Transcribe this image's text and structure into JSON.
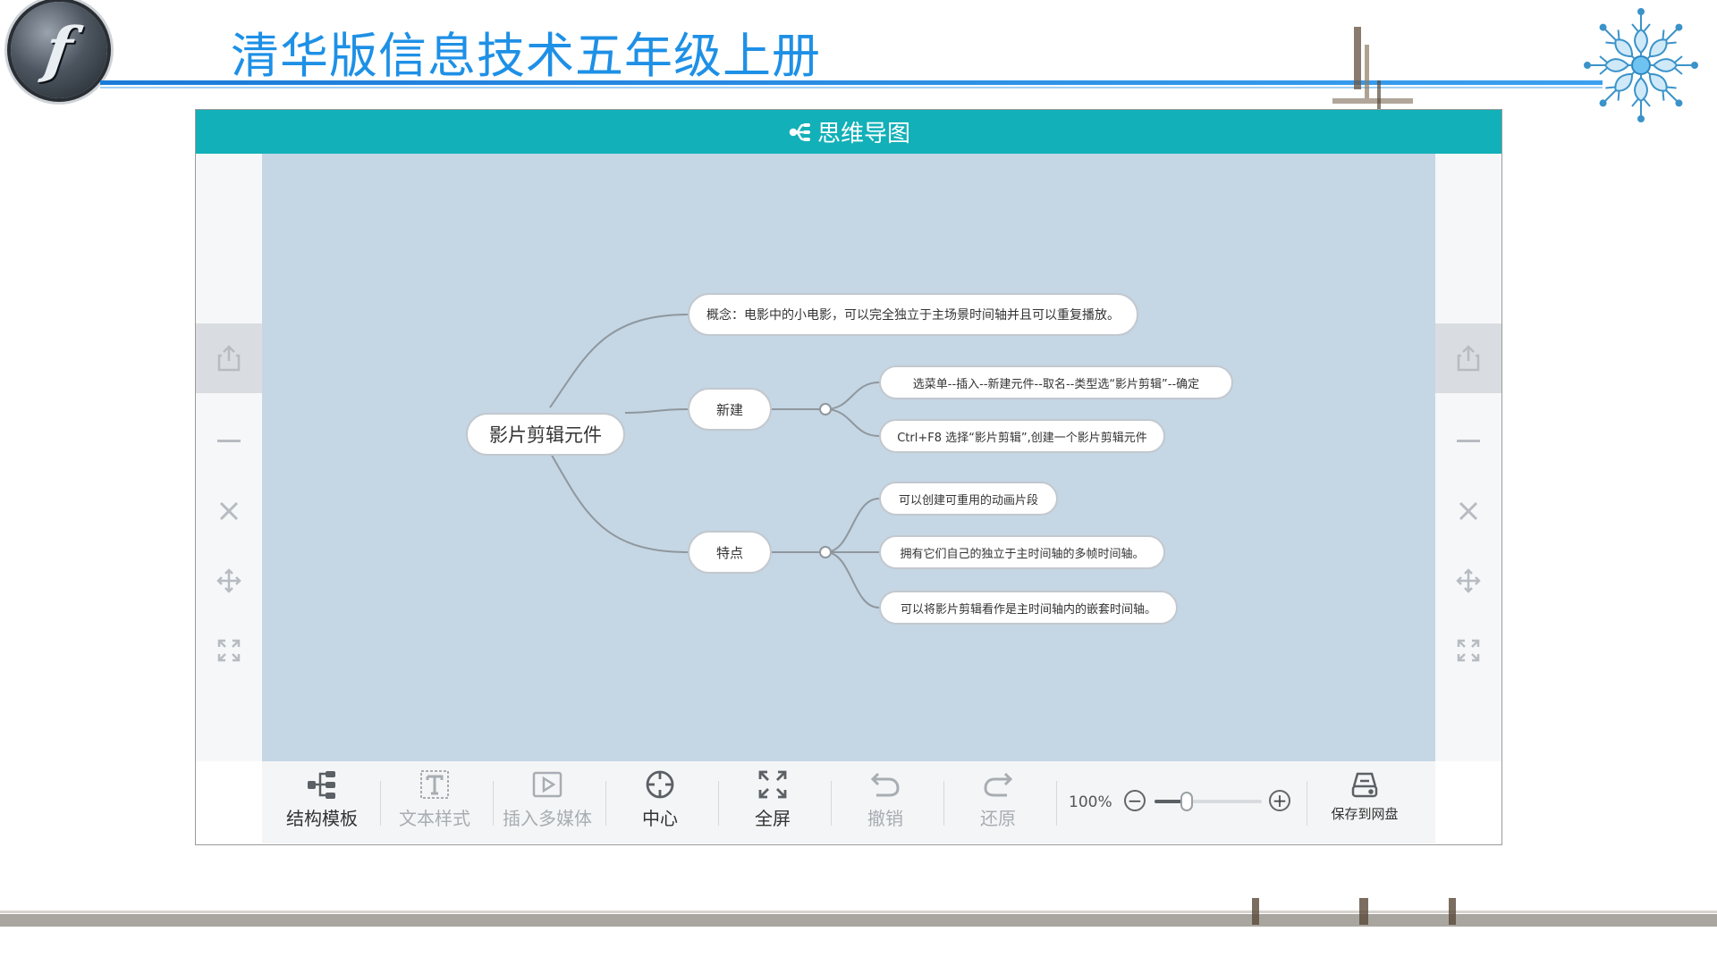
{
  "slide": {
    "title": "清华版信息技术五年级上册",
    "logo_letter": "f"
  },
  "app": {
    "header_title": "思维导图",
    "side_icons": [
      "share-icon",
      "minus-icon",
      "close-icon",
      "move-icon",
      "fit-screen-icon"
    ]
  },
  "mindmap": {
    "root": "影片剪辑元件",
    "branches": [
      {
        "label": "概念：电影中的小电影，可以完全独立于主场景时间轴并且可以重复播放。"
      },
      {
        "label": "新建",
        "children": [
          "选菜单--插入--新建元件--取名--类型选“影片剪辑”--确定",
          "Ctrl+F8 选择“影片剪辑”,创建一个影片剪辑元件"
        ]
      },
      {
        "label": "特点",
        "children": [
          "可以创建可重用的动画片段",
          "拥有它们自己的独立于主时间轴的多帧时间轴。",
          "可以将影片剪辑看作是主时间轴内的嵌套时间轴。"
        ]
      }
    ]
  },
  "toolbar": {
    "structure": "结构模板",
    "text_style": "文本样式",
    "insert_media": "插入多媒体",
    "center": "中心",
    "fullscreen": "全屏",
    "undo": "撤销",
    "redo": "还原",
    "zoom_label": "100%",
    "zoom_level": 0.3,
    "zoom_minus": "−",
    "zoom_plus": "+",
    "save": "保存到网盘"
  },
  "colors": {
    "header": "#12b0b8",
    "canvas": "#c5d6e4",
    "title": "#1e90e6"
  }
}
